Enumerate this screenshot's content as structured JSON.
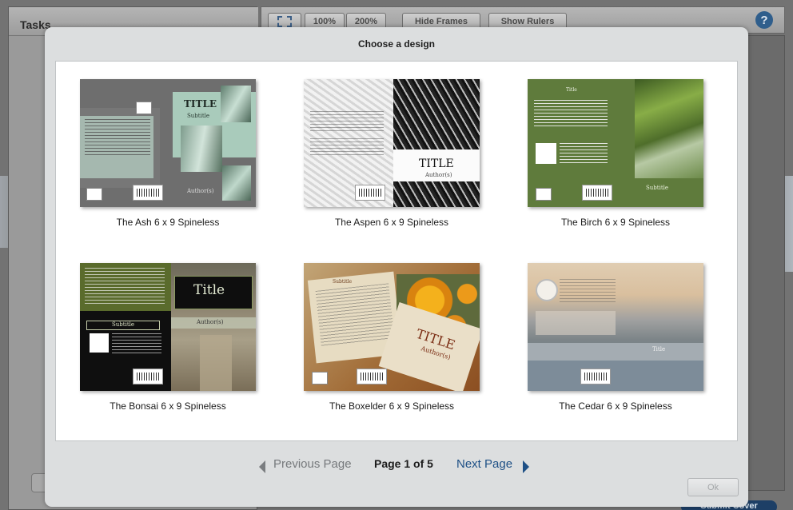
{
  "app": {
    "tasks_title": "Tasks",
    "toolbar": {
      "zoom_100": "100%",
      "zoom_200": "200%",
      "hide_frames": "Hide Frames",
      "show_rulers": "Show Rulers",
      "help": "?"
    },
    "submit_label": "Submit Cover"
  },
  "modal": {
    "title": "Choose a design",
    "designs": [
      {
        "name": "The Ash 6 x 9 Spineless",
        "thumb_title": "TITLE",
        "thumb_subtitle": "Subtitle",
        "thumb_author": "Author(s)"
      },
      {
        "name": "The Aspen 6 x 9 Spineless",
        "thumb_title": "TITLE",
        "thumb_author": "Author(s)"
      },
      {
        "name": "The Birch 6 x 9 Spineless",
        "thumb_title": "Title",
        "thumb_subtitle": "Subtitle"
      },
      {
        "name": "The Bonsai 6 x 9 Spineless",
        "thumb_title": "Title",
        "thumb_subtitle": "Subtitle",
        "thumb_author": "Author(s)"
      },
      {
        "name": "The Boxelder 6 x 9 Spineless",
        "thumb_title": "TITLE",
        "thumb_subtitle": "Subtitle",
        "thumb_author": "Author(s)"
      },
      {
        "name": "The Cedar 6 x 9 Spineless",
        "thumb_title": "Title"
      }
    ],
    "pagination": {
      "previous": "Previous Page",
      "indicator": "Page 1 of 5",
      "next": "Next Page"
    },
    "ok_label": "Ok"
  },
  "colors": {
    "link_active": "#1e5086",
    "link_disabled": "#76797c",
    "modal_bg": "#dcdedf"
  }
}
